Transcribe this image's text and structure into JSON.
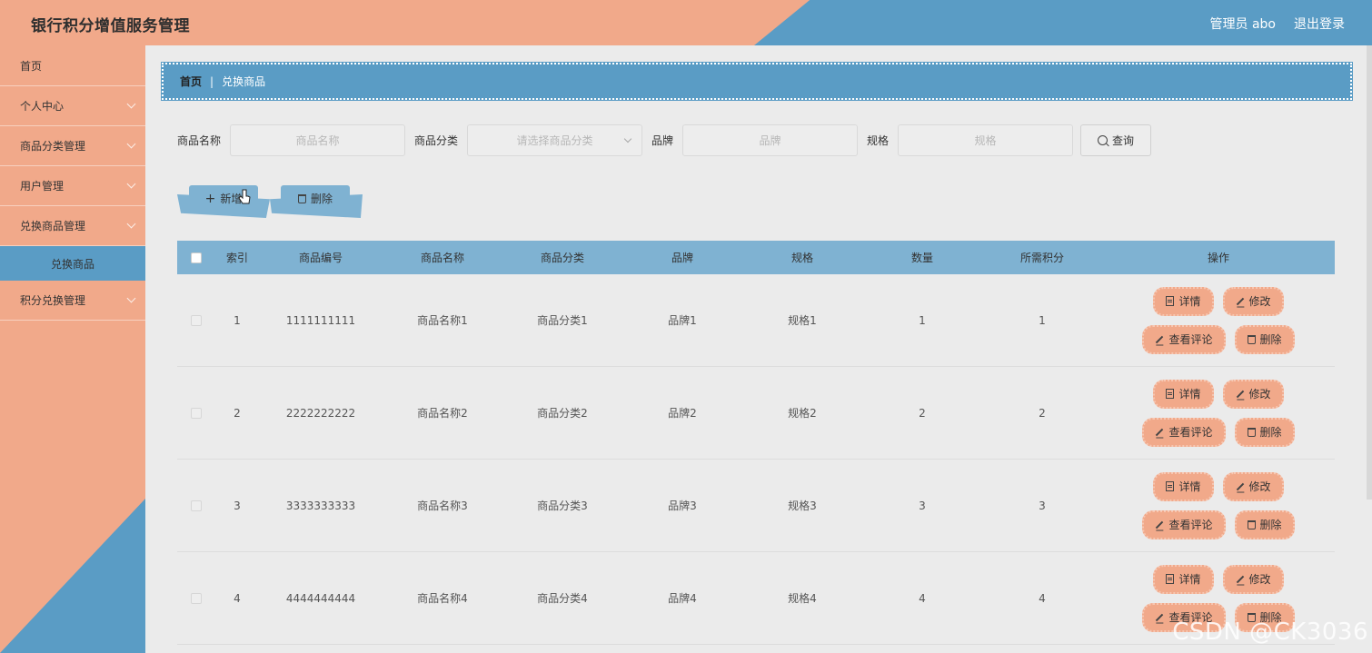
{
  "header": {
    "title": "银行积分增值服务管理",
    "user_label": "管理员 abo",
    "logout_label": "退出登录"
  },
  "sidebar": {
    "items": [
      {
        "label": "首页"
      },
      {
        "label": "个人中心"
      },
      {
        "label": "商品分类管理"
      },
      {
        "label": "用户管理"
      },
      {
        "label": "兑换商品管理"
      },
      {
        "label": "兑换商品"
      },
      {
        "label": "积分兑换管理"
      }
    ]
  },
  "breadcrumb": {
    "home": "首页",
    "separator": "|",
    "current": "兑换商品"
  },
  "search": {
    "name_label": "商品名称",
    "name_placeholder": "商品名称",
    "category_label": "商品分类",
    "category_placeholder": "请选择商品分类",
    "brand_label": "品牌",
    "brand_placeholder": "品牌",
    "spec_label": "规格",
    "spec_placeholder": "规格",
    "query_label": "查询"
  },
  "actions": {
    "add_label": "新增",
    "delete_label": "删除"
  },
  "table": {
    "headers": [
      "索引",
      "商品编号",
      "商品名称",
      "商品分类",
      "品牌",
      "规格",
      "数量",
      "所需积分",
      "操作"
    ],
    "rows": [
      {
        "idx": "1",
        "code": "1111111111",
        "name": "商品名称1",
        "category": "商品分类1",
        "brand": "品牌1",
        "spec": "规格1",
        "qty": "1",
        "points": "1"
      },
      {
        "idx": "2",
        "code": "2222222222",
        "name": "商品名称2",
        "category": "商品分类2",
        "brand": "品牌2",
        "spec": "规格2",
        "qty": "2",
        "points": "2"
      },
      {
        "idx": "3",
        "code": "3333333333",
        "name": "商品名称3",
        "category": "商品分类3",
        "brand": "品牌3",
        "spec": "规格3",
        "qty": "3",
        "points": "3"
      },
      {
        "idx": "4",
        "code": "4444444444",
        "name": "商品名称4",
        "category": "商品分类4",
        "brand": "品牌4",
        "spec": "规格4",
        "qty": "4",
        "points": "4"
      }
    ],
    "op_detail": "详情",
    "op_edit": "修改",
    "op_comments": "查看评论",
    "op_delete": "删除"
  },
  "watermark": "CSDN @CK3036",
  "colors": {
    "peach": "#f1a98a",
    "blue": "#5a9cc5",
    "light_blue": "#7fb2d2",
    "background": "#ebebeb"
  }
}
